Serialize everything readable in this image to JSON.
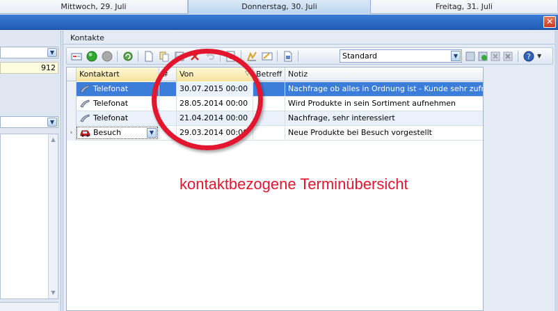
{
  "days": [
    "Mittwoch, 29. Juli",
    "Donnerstag, 30. Juli",
    "Freitag, 31. Juli"
  ],
  "left": {
    "number": "912"
  },
  "panel": {
    "title": "Kontakte"
  },
  "toolbar": {
    "view_value": "Standard"
  },
  "grid": {
    "headers": {
      "kontaktart": "Kontaktart",
      "nr": "#",
      "von": "Von",
      "betreff": "Betreff",
      "notiz": "Notiz"
    },
    "rows": [
      {
        "kontaktart": "Telefonat",
        "von": "30.07.2015 00:00",
        "notiz": "Nachfrage ob alles in Ordnung ist - Kunde sehr zufrieden",
        "icon": "phone-icon"
      },
      {
        "kontaktart": "Telefonat",
        "von": "28.05.2014 00:00",
        "notiz": "Wird Produkte in sein Sortiment aufnehmen",
        "icon": "phone-icon"
      },
      {
        "kontaktart": "Telefonat",
        "von": "21.04.2014 00:00",
        "notiz": "Nachfrage, sehr interessiert",
        "icon": "phone-icon"
      },
      {
        "kontaktart": "Besuch",
        "von": "29.03.2014 00:00",
        "notiz": "Neue Produkte bei Besuch vorgestellt",
        "icon": "car-icon"
      }
    ]
  },
  "annotation": "kontaktbezogene Terminübersicht",
  "colors": {
    "accent": "#3b7dd8",
    "annotation": "#e2162e",
    "titlebar": "#1f5cb6"
  }
}
